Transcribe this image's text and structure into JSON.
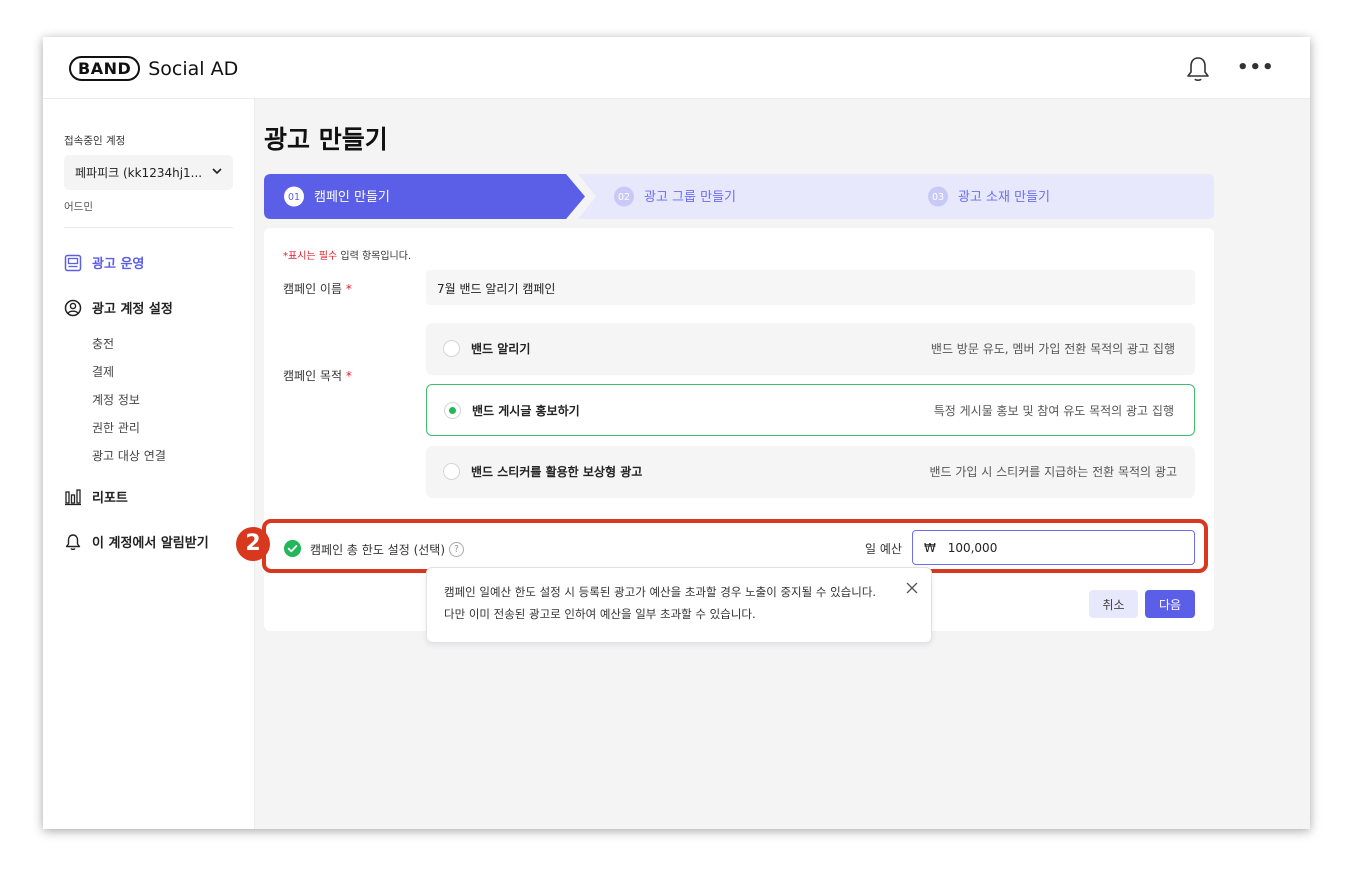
{
  "header": {
    "logo_band": "BAND",
    "logo_text": "Social AD",
    "more_label": "•••"
  },
  "sidebar": {
    "account_label": "접속중인 계정",
    "account_value": "페파피크 (kk1234hj1...",
    "role": "어드민",
    "nav": [
      {
        "label": "광고 운영",
        "icon": "ad-board-icon",
        "active": true
      },
      {
        "label": "광고 계정 설정",
        "icon": "user-circle-icon",
        "active": false
      },
      {
        "label": "리포트",
        "icon": "bar-chart-icon",
        "active": false
      },
      {
        "label": "이 계정에서 알림받기",
        "icon": "bell-icon",
        "active": false
      }
    ],
    "sub_items": [
      "충전",
      "결제",
      "계정 정보",
      "권한 관리",
      "광고 대상 연결"
    ]
  },
  "main": {
    "title": "광고 만들기",
    "steps": [
      {
        "num": "01",
        "label": "캠페인 만들기",
        "active": true
      },
      {
        "num": "02",
        "label": "광고 그룹 만들기",
        "active": false
      },
      {
        "num": "03",
        "label": "광고 소재 만들기",
        "active": false
      }
    ],
    "required_note_prefix": "*표시는 필수",
    "required_note_suffix": " 입력 항목입니다.",
    "campaign_name_label": "캠페인 이름",
    "campaign_name_value": "7월 밴드 알리기 캠페인",
    "objective_label": "캠페인 목적",
    "required_star": "*",
    "objectives": [
      {
        "title": "밴드 알리기",
        "desc": "밴드 방문 유도, 멤버 가입 전환 목적의 광고 집행",
        "selected": false
      },
      {
        "title": "밴드 게시글 홍보하기",
        "desc": "특정 게시물 홍보 및 참여 유도 목적의 광고 집행",
        "selected": true
      },
      {
        "title": "밴드 스티커를 활용한 보상형 광고",
        "desc": "밴드 가입 시 스티커를 지급하는 전환 목적의 광고",
        "selected": false
      }
    ],
    "limit_label": "캠페인 총 한도 설정 (선택)",
    "help_symbol": "?",
    "budget_label": "일 예산",
    "currency": "₩",
    "budget_value": "100,000",
    "annotation_number": "2",
    "tooltip_line1": "캠페인 일예산 한도 설정 시 등록된 광고가 예산을 초과할 경우 노출이 중지될 수 있습니다.",
    "tooltip_line2": "다만 이미 전송된 광고로 인하여 예산을 일부 초과할 수 있습니다.",
    "cancel_label": "취소",
    "next_label": "다음"
  },
  "colors": {
    "accent": "#5b5ee6",
    "step_inactive": "#e8e8fc",
    "success": "#22b85a",
    "annotation": "#d7381e"
  }
}
